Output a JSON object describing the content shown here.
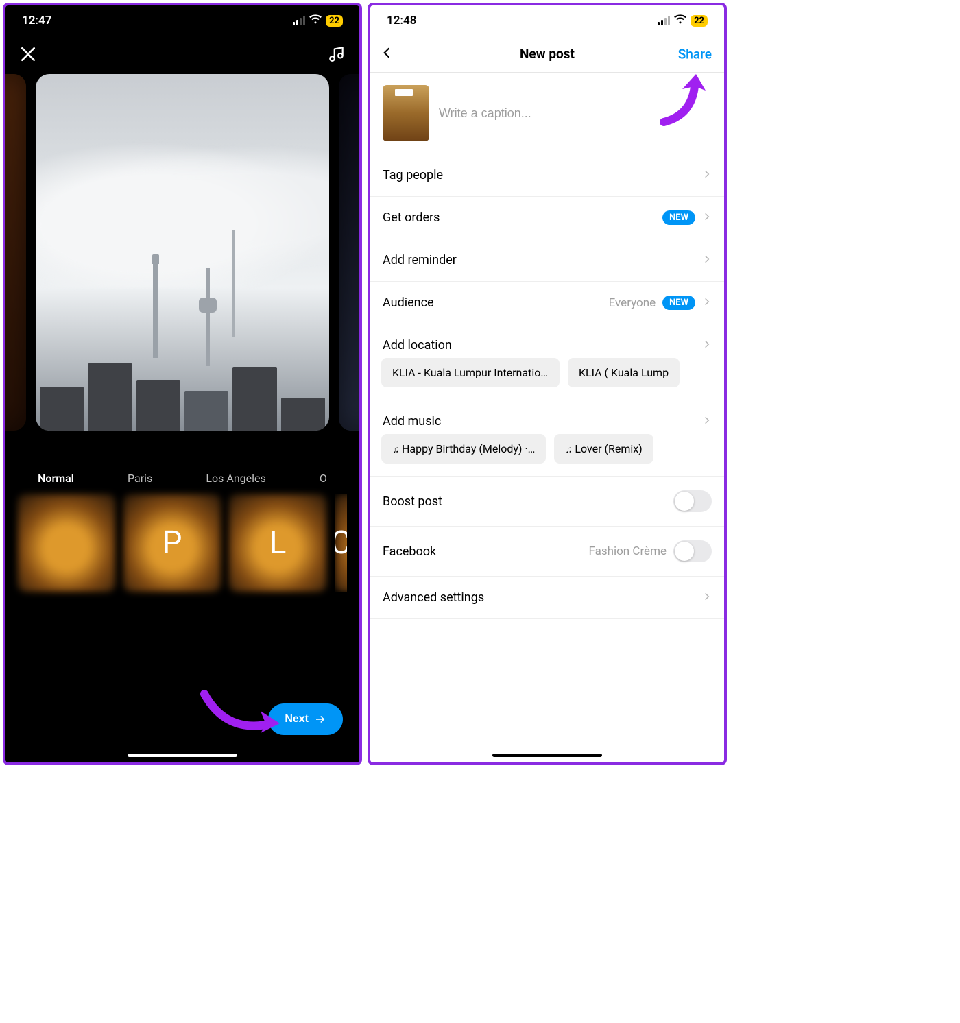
{
  "left": {
    "status": {
      "time": "12:47",
      "battery": "22"
    },
    "filters": {
      "names": {
        "f0": "Normal",
        "f1": "Paris",
        "f2": "Los Angeles",
        "f3": "O"
      },
      "letters": {
        "l1": "P",
        "l2": "L",
        "l3": "C"
      }
    },
    "next_label": "Next"
  },
  "right": {
    "status": {
      "time": "12:48",
      "battery": "22"
    },
    "nav": {
      "title": "New post",
      "share": "Share"
    },
    "caption_placeholder": "Write a caption...",
    "rows": {
      "tag_people": "Tag people",
      "get_orders": "Get orders",
      "get_orders_badge": "NEW",
      "add_reminder": "Add reminder",
      "audience": "Audience",
      "audience_value": "Everyone",
      "audience_badge": "NEW",
      "add_location": "Add location",
      "add_music": "Add music",
      "boost_post": "Boost post",
      "facebook": "Facebook",
      "facebook_value": "Fashion Crème",
      "advanced": "Advanced settings"
    },
    "locations": {
      "l0": "KLIA - Kuala Lumpur Internation…",
      "l1": "KLIA ( Kuala Lump"
    },
    "music": {
      "m0": "Happy Birthday (Melody) ·…",
      "m1": "Lover (Remix)"
    }
  }
}
